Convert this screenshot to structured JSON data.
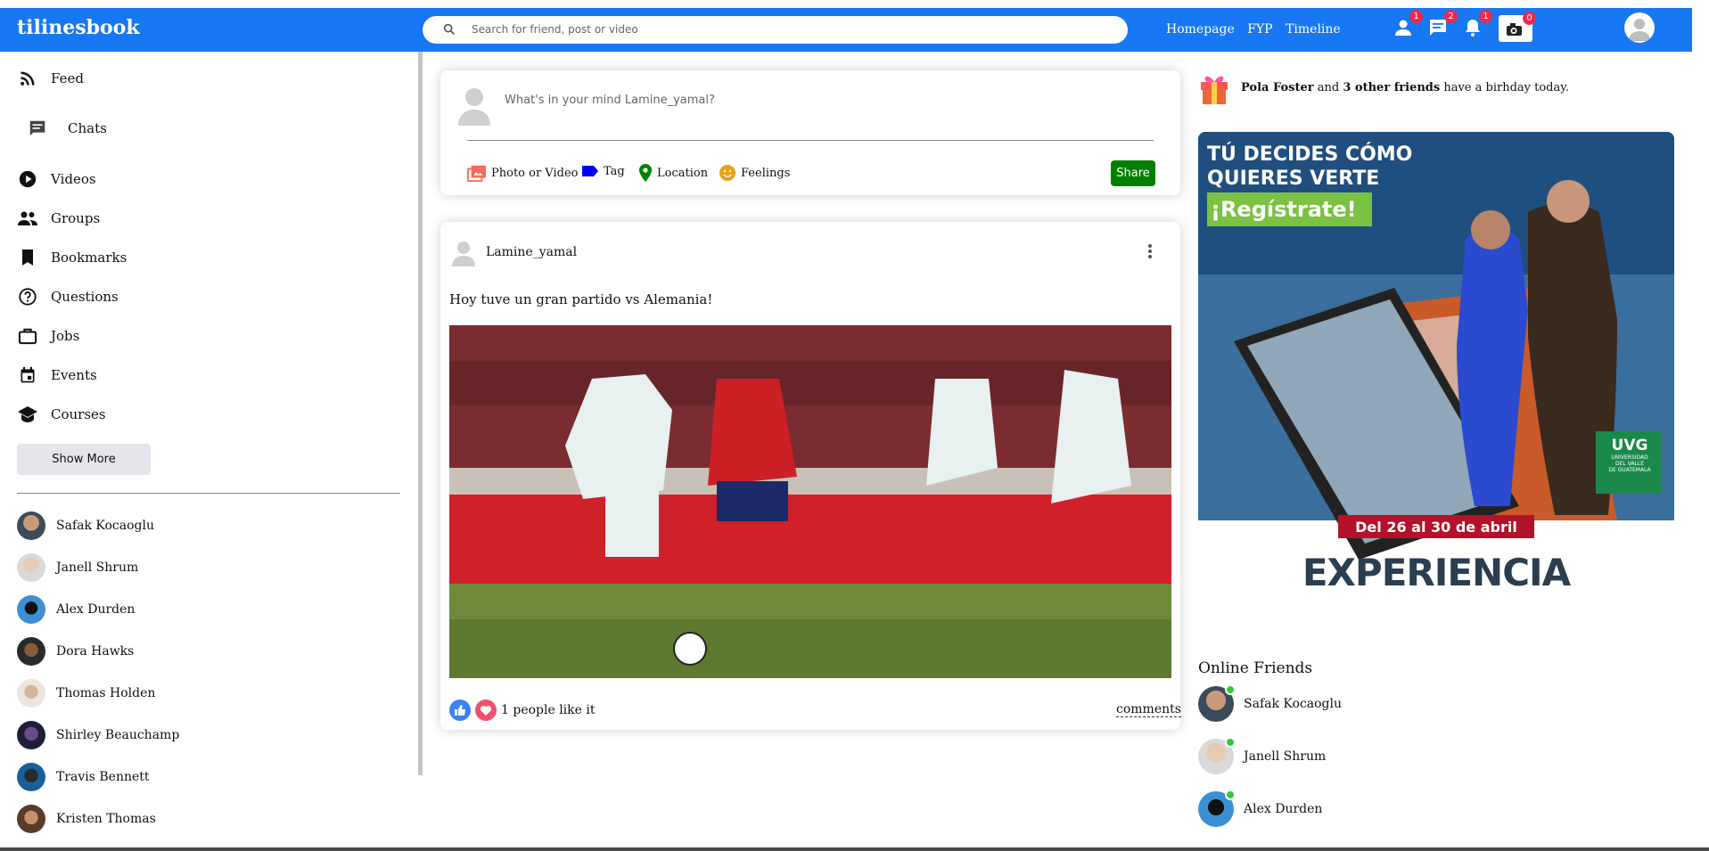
{
  "header": {
    "logo": "tilinesbook",
    "search_placeholder": "Search for friend, post or video",
    "links": [
      "Homepage",
      "FYP",
      "Timeline"
    ],
    "badges": {
      "friends": "1",
      "messages": "2",
      "notifications": "1",
      "camera": "0"
    }
  },
  "sidebar": {
    "items": [
      {
        "label": "Feed",
        "icon": "rss-icon"
      },
      {
        "label": "Chats",
        "icon": "chat-icon"
      },
      {
        "label": "Videos",
        "icon": "play-circle-icon"
      },
      {
        "label": "Groups",
        "icon": "group-icon"
      },
      {
        "label": "Bookmarks",
        "icon": "bookmark-icon"
      },
      {
        "label": "Questions",
        "icon": "help-circle-icon"
      },
      {
        "label": "Jobs",
        "icon": "briefcase-icon"
      },
      {
        "label": "Events",
        "icon": "calendar-icon"
      },
      {
        "label": "Courses",
        "icon": "school-icon"
      }
    ],
    "show_more": "Show More",
    "friends": [
      "Safak Kocaoglu",
      "Janell Shrum",
      "Alex Durden",
      "Dora Hawks",
      "Thomas Holden",
      "Shirley Beauchamp",
      "Travis Bennett",
      "Kristen Thomas"
    ]
  },
  "share": {
    "placeholder": "What's in your mind Lamine_yamal?",
    "options": [
      "Photo or Video",
      "Tag",
      "Location",
      "Feelings"
    ],
    "share_button": "Share"
  },
  "post": {
    "username": "Lamine_yamal",
    "text": "Hoy tuve un gran partido vs Alemania!",
    "likes": "1 people like it",
    "comments": "comments"
  },
  "rightbar": {
    "bday_name": "Pola Foster",
    "bday_and": " and ",
    "bday_others": "3 other friends",
    "bday_rest": " have a birhday today.",
    "ad": {
      "line1": "TÚ DECIDES CÓMO",
      "line2": "QUIERES VERTE",
      "cta": "¡Regístrate!",
      "logo": "UVG",
      "logo_sub1": "UNIVERSIDAD",
      "logo_sub2": "DEL VALLE",
      "logo_sub3": "DE GUATEMALA",
      "dates": "Del 26 al 30 de abril",
      "brand": "EXPERIENCIA"
    },
    "online_title": "Online Friends",
    "online": [
      "Safak Kocaoglu",
      "Janell Shrum",
      "Alex Durden"
    ]
  },
  "colors": {
    "brand": "#1877f2",
    "share": "#008000",
    "badge": "#f02849",
    "online": "#32cd32"
  }
}
